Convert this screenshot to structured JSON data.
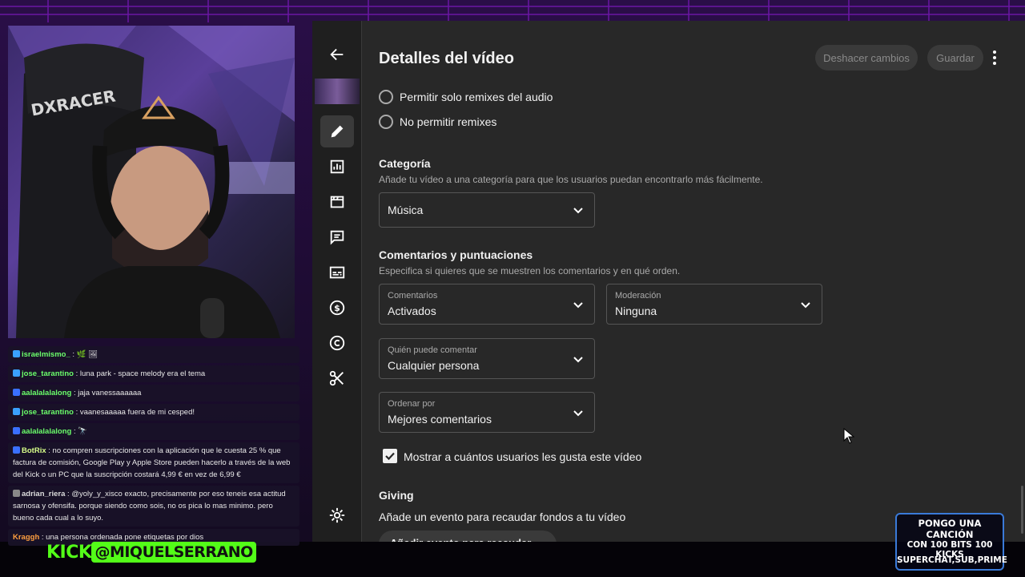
{
  "stream": {
    "kick_word": "KICK",
    "kick_handle": "@MIQUELSERRANO",
    "promo_line1": "PONGO UNA CANCIÓN",
    "promo_line2": "CON 100 BITS 100 KICKS",
    "promo_line3": "SUPERCHAT,SUB,PRIME",
    "accent_color": "#53fc18",
    "bg_color": "#120a1e"
  },
  "webcam": {
    "chair_brand": "DXRACER"
  },
  "chat": {
    "messages": [
      {
        "user": "israelmismo_",
        "text": ""
      },
      {
        "user": "jose_tarantino",
        "text": "luna park - space melody era el tema"
      },
      {
        "user": "aalalalalalong",
        "text": "jaja vanessaaaaaa"
      },
      {
        "user": "jose_tarantino",
        "text": "vaanesaaaaa fuera de mi cesped!"
      },
      {
        "user": "aalalalalalong",
        "text": ""
      },
      {
        "user": "BotRix",
        "text": "no compren suscripciones con la aplicación que le cuesta 25 % que factura de comisión, Google Play y Apple Store pueden hacerlo a través de la web del Kick o un PC que la suscripción costará 4,99 € en vez de 6,99 €"
      },
      {
        "user": "adrian_riera",
        "text": "@yoly_y_xisco exacto, precisamente por eso teneis esa actitud sarnosa y ofensifa. porque siendo como sois, no os pica lo mas minimo. pero bueno cada cual a lo suyo."
      },
      {
        "user": "Kraggh",
        "text": "una persona ordenada pone etiquetas por dios"
      }
    ]
  },
  "studio": {
    "title": "Detalles del vídeo",
    "undo_label": "Deshacer cambios",
    "save_label": "Guardar",
    "remix": {
      "option_audio": "Permitir solo remixes del audio",
      "option_none": "No permitir remixes"
    },
    "category": {
      "title": "Categoría",
      "desc": "Añade tu vídeo a una categoría para que los usuarios puedan encontrarlo más fácilmente.",
      "value": "Música"
    },
    "comments": {
      "title": "Comentarios y puntuaciones",
      "desc": "Especifica si quieres que se muestren los comentarios y en qué orden.",
      "comments_label": "Comentarios",
      "comments_value": "Activados",
      "moderation_label": "Moderación",
      "moderation_value": "Ninguna",
      "who_label": "Quién puede comentar",
      "who_value": "Cualquier persona",
      "sort_label": "Ordenar por",
      "sort_value": "Mejores comentarios"
    },
    "likes_label": "Mostrar a cuántos usuarios les gusta este vídeo",
    "likes_checked": true,
    "giving": {
      "title": "Giving",
      "desc": "Añade un evento para recaudar fondos a tu vídeo",
      "button": "Añadir evento para recaudar fondos"
    },
    "rail_icons": [
      "back-arrow-icon",
      "pencil-icon",
      "analytics-icon",
      "editor-icon",
      "comments-icon",
      "subtitles-icon",
      "monetization-icon",
      "copyright-icon",
      "clips-icon",
      "settings-icon"
    ]
  }
}
